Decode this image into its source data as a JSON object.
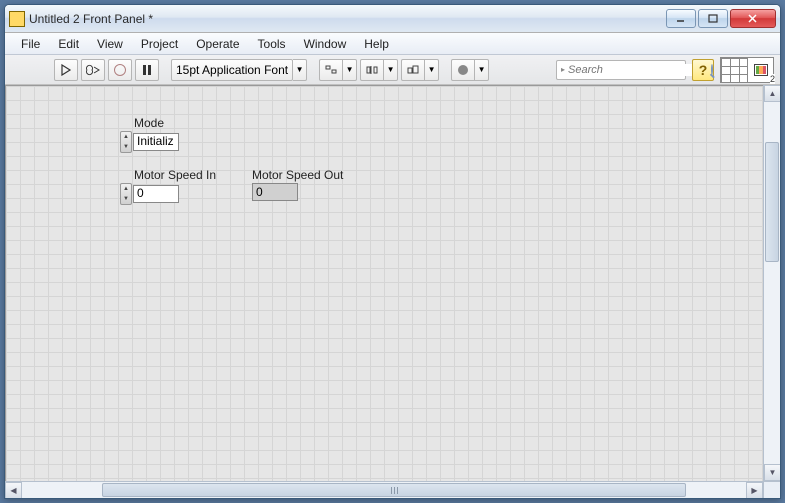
{
  "window": {
    "title": "Untitled 2 Front Panel *"
  },
  "menu": {
    "items": [
      "File",
      "Edit",
      "View",
      "Project",
      "Operate",
      "Tools",
      "Window",
      "Help"
    ]
  },
  "toolbar": {
    "font_label": "15pt Application Font",
    "search_placeholder": "Search",
    "help_label": "?",
    "corner_index": "2"
  },
  "controls": {
    "mode": {
      "label": "Mode",
      "value": "Initializ"
    },
    "motor_speed_in": {
      "label": "Motor Speed In",
      "value": "0"
    },
    "motor_speed_out": {
      "label": "Motor Speed Out",
      "value": "0"
    }
  }
}
